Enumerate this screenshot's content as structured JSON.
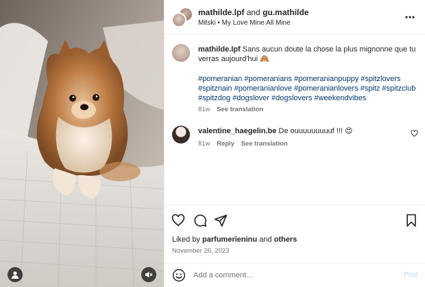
{
  "header": {
    "user1": "mathilde.lpf",
    "joiner": "and",
    "user2": "gu.mathilde",
    "audio": "Mitski • My Love Mine All Mine"
  },
  "caption": {
    "username": "mathilde.lpf",
    "text": "Sans aucun doute la chose la plus mignonne que tu verras aujourd'hui 🙈",
    "hashtags": "#pomeranian #pomeranians #pomeranianpuppy #spitzlovers #spitznain #pomeranianlove #pomeranianlovers #spitz #spitzclub #spitzdog #dogslover #dogslovers #weekendvibes",
    "age": "81w",
    "see_translation": "See translation"
  },
  "comment": {
    "username": "valentine_haegelin.be",
    "text": "De ouuuuuuuuuf !!! 😍",
    "age": "81w",
    "reply": "Reply",
    "see_translation": "See translation"
  },
  "likes": {
    "prefix": "Liked by",
    "user": "parfumerieninu",
    "joiner": "and",
    "others": "others"
  },
  "date": "November 26, 2023",
  "add_comment": {
    "placeholder": "Add a comment...",
    "post_label": "Post"
  },
  "icons": {
    "more": "more-horizontal-icon",
    "like": "heart-icon",
    "comment": "comment-icon",
    "share": "share-icon",
    "save": "bookmark-icon",
    "emoji": "emoji-icon",
    "user_tag": "user-icon",
    "mute": "volume-mute-icon"
  },
  "colors": {
    "text": "#262626",
    "secondary": "#737373",
    "hashtag": "#00376b",
    "post_disabled": "#b3dbff",
    "divider": "#efefef"
  }
}
